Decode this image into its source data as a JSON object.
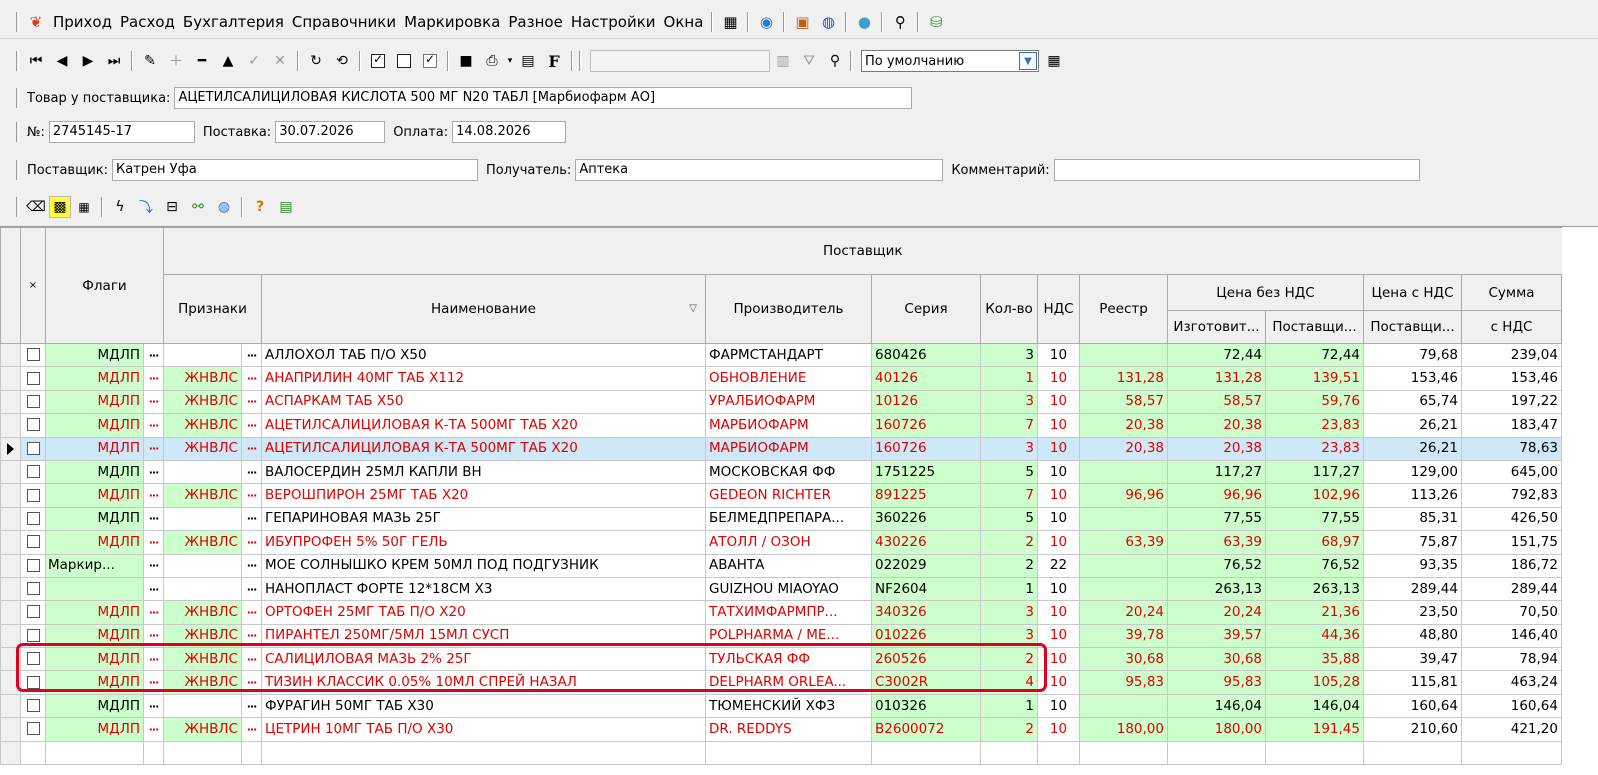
{
  "menu": {
    "items": [
      "Приход",
      "Расход",
      "Бухгалтерия",
      "Справочники",
      "Маркировка",
      "Разное",
      "Настройки",
      "Окна"
    ],
    "icons": [
      "app-logo-icon",
      "calendar-icon",
      "globe-icon",
      "box-icon",
      "help-icon",
      "refresh-circle-icon",
      "search-icon",
      "basket-icon"
    ]
  },
  "toolbar2": {
    "profile_select": "По умолчанию"
  },
  "form": {
    "product_label": "Товар у поставщика:",
    "product_value": "АЦЕТИЛСАЛИЦИЛОВАЯ КИСЛОТА 500 МГ N20 ТАБЛ [Марбиофарм АО]",
    "number_label": "№:",
    "number_value": "2745145-17",
    "delivery_label": "Поставка:",
    "delivery_value": "30.07.2026",
    "payment_label": "Оплата:",
    "payment_value": "14.08.2026",
    "supplier_label": "Поставщик:",
    "supplier_value": "Катрен Уфа",
    "recipient_label": "Получатель:",
    "recipient_value": "Аптека",
    "comment_label": "Комментарий:",
    "comment_value": ""
  },
  "grid": {
    "headers": {
      "select": "×",
      "flags": "Флаги",
      "supplier_group": "Поставщик",
      "signs": "Признаки",
      "name": "Наименование",
      "manufacturer": "Производитель",
      "series": "Серия",
      "qty": "Кол-во",
      "vat": "НДС",
      "registry": "Реестр",
      "price_no_vat": "Цена без НДС",
      "price_vat": "Цена с НДС",
      "sum": "Сумма",
      "manuf_price": "Изготовит...",
      "supp_price": "Поставщи...",
      "supp_price_vat": "Поставщи...",
      "sum_vat": "с НДС"
    },
    "rows": [
      {
        "flag": "МДЛП",
        "sign": "",
        "name": "АЛЛОХОЛ ТАБ П/О Х50",
        "manuf": "ФАРМСТАНДАРТ",
        "series": "680426",
        "qty": "3",
        "vat": "10",
        "reg": "",
        "pm": "72,44",
        "ps": "72,44",
        "pv": "79,68",
        "sum": "239,04",
        "red": false
      },
      {
        "flag": "МДЛП",
        "sign": "ЖНВЛС",
        "name": "АНАПРИЛИН 40МГ ТАБ Х112",
        "manuf": "ОБНОВЛЕНИЕ",
        "series": "40126",
        "qty": "1",
        "vat": "10",
        "reg": "131,28",
        "pm": "131,28",
        "ps": "139,51",
        "pv": "153,46",
        "sum": "153,46",
        "red": true
      },
      {
        "flag": "МДЛП",
        "sign": "ЖНВЛС",
        "name": "АСПАРКАМ ТАБ Х50",
        "manuf": "УРАЛБИОФАРМ",
        "series": "10126",
        "qty": "3",
        "vat": "10",
        "reg": "58,57",
        "pm": "58,57",
        "ps": "59,76",
        "pv": "65,74",
        "sum": "197,22",
        "red": true
      },
      {
        "flag": "МДЛП",
        "sign": "ЖНВЛС",
        "name": "АЦЕТИЛСАЛИЦИЛОВАЯ К-ТА 500МГ ТАБ Х20",
        "manuf": "МАРБИОФАРМ",
        "series": "160726",
        "qty": "7",
        "vat": "10",
        "reg": "20,38",
        "pm": "20,38",
        "ps": "23,83",
        "pv": "26,21",
        "sum": "183,47",
        "red": true
      },
      {
        "flag": "МДЛП",
        "sign": "ЖНВЛС",
        "name": "АЦЕТИЛСАЛИЦИЛОВАЯ К-ТА 500МГ ТАБ Х20",
        "manuf": "МАРБИОФАРМ",
        "series": "160726",
        "qty": "3",
        "vat": "10",
        "reg": "20,38",
        "pm": "20,38",
        "ps": "23,83",
        "pv": "26,21",
        "sum": "78,63",
        "red": true,
        "current": true
      },
      {
        "flag": "МДЛП",
        "sign": "",
        "name": "ВАЛОСЕРДИН 25МЛ КАПЛИ ВН",
        "manuf": "МОСКОВСКАЯ ФФ",
        "series": "1751225",
        "qty": "5",
        "vat": "10",
        "reg": "",
        "pm": "117,27",
        "ps": "117,27",
        "pv": "129,00",
        "sum": "645,00",
        "red": false
      },
      {
        "flag": "МДЛП",
        "sign": "ЖНВЛС",
        "name": "ВЕРОШПИРОН 25МГ ТАБ Х20",
        "manuf": "GEDEON RICHTER",
        "series": "891225",
        "qty": "7",
        "vat": "10",
        "reg": "96,96",
        "pm": "96,96",
        "ps": "102,96",
        "pv": "113,26",
        "sum": "792,83",
        "red": true
      },
      {
        "flag": "МДЛП",
        "sign": "",
        "name": "ГЕПАРИНОВАЯ МАЗЬ 25Г",
        "manuf": "БЕЛМЕДПРЕПАРА...",
        "series": "360226",
        "qty": "5",
        "vat": "10",
        "reg": "",
        "pm": "77,55",
        "ps": "77,55",
        "pv": "85,31",
        "sum": "426,50",
        "red": false
      },
      {
        "flag": "МДЛП",
        "sign": "ЖНВЛС",
        "name": "ИБУПРОФЕН 5% 50Г ГЕЛЬ",
        "manuf": "АТОЛЛ / ОЗОН",
        "series": "430226",
        "qty": "2",
        "vat": "10",
        "reg": "63,39",
        "pm": "63,39",
        "ps": "68,97",
        "pv": "75,87",
        "sum": "151,75",
        "red": true
      },
      {
        "flag": "Маркир...",
        "sign": "",
        "name": "МОЕ СОЛНЫШКО КРЕМ 50МЛ ПОД ПОДГУЗНИК",
        "manuf": "АВАНТА",
        "series": "022029",
        "qty": "2",
        "vat": "22",
        "reg": "",
        "pm": "76,52",
        "ps": "76,52",
        "pv": "93,35",
        "sum": "186,72",
        "red": false,
        "left_flag": true
      },
      {
        "flag": "",
        "sign": "",
        "name": "НАНОПЛАСТ ФОРТЕ 12*18СМ Х3",
        "manuf": "GUIZHOU MIAOYAO",
        "series": "NF2604",
        "qty": "1",
        "vat": "10",
        "reg": "",
        "pm": "263,13",
        "ps": "263,13",
        "pv": "289,44",
        "sum": "289,44",
        "red": false
      },
      {
        "flag": "МДЛП",
        "sign": "ЖНВЛС",
        "name": "ОРТОФЕН 25МГ ТАБ П/О Х20",
        "manuf": "ТАТХИМФАРМПР...",
        "series": "340326",
        "qty": "3",
        "vat": "10",
        "reg": "20,24",
        "pm": "20,24",
        "ps": "21,36",
        "pv": "23,50",
        "sum": "70,50",
        "red": true
      },
      {
        "flag": "МДЛП",
        "sign": "ЖНВЛС",
        "name": "ПИРАНТЕЛ 250МГ/5МЛ 15МЛ СУСП",
        "manuf": "POLPHARMA / МЕ...",
        "series": "010226",
        "qty": "3",
        "vat": "10",
        "reg": "39,78",
        "pm": "39,57",
        "ps": "44,36",
        "pv": "48,80",
        "sum": "146,40",
        "red": true
      },
      {
        "flag": "МДЛП",
        "sign": "ЖНВЛС",
        "name": "САЛИЦИЛОВАЯ МАЗЬ 2% 25Г",
        "manuf": "ТУЛЬСКАЯ ФФ",
        "series": "260526",
        "qty": "2",
        "vat": "10",
        "reg": "30,68",
        "pm": "30,68",
        "ps": "35,88",
        "pv": "39,47",
        "sum": "78,94",
        "red": true
      },
      {
        "flag": "МДЛП",
        "sign": "ЖНВЛС",
        "name": "ТИЗИН КЛАССИК 0.05% 10МЛ СПРЕЙ НАЗАЛ",
        "manuf": "DELPHARM ORLEA...",
        "series": "C3002R",
        "qty": "4",
        "vat": "10",
        "reg": "95,83",
        "pm": "95,83",
        "ps": "105,28",
        "pv": "115,81",
        "sum": "463,24",
        "red": true
      },
      {
        "flag": "МДЛП",
        "sign": "",
        "name": "ФУРАГИН 50МГ ТАБ Х30",
        "manuf": "ТЮМЕНСКИЙ ХФЗ",
        "series": "010326",
        "qty": "1",
        "vat": "10",
        "reg": "",
        "pm": "146,04",
        "ps": "146,04",
        "pv": "160,64",
        "sum": "160,64",
        "red": false
      },
      {
        "flag": "МДЛП",
        "sign": "ЖНВЛС",
        "name": "ЦЕТРИН 10МГ ТАБ П/О Х30",
        "manuf": "DR. REDDYS",
        "series": "B2600072",
        "qty": "2",
        "vat": "10",
        "reg": "180,00",
        "pm": "180,00",
        "ps": "191,45",
        "pv": "210,60",
        "sum": "421,20",
        "red": true
      }
    ]
  }
}
